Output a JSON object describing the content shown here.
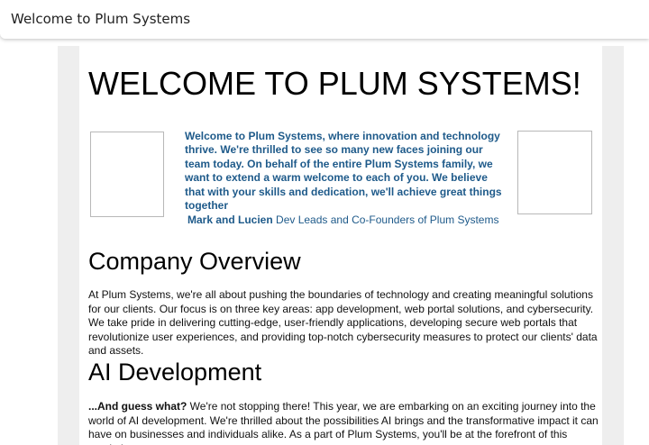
{
  "window": {
    "title": "Welcome to Plum Systems"
  },
  "hero": {
    "title": "WELCOME TO PLUM SYSTEMS!"
  },
  "welcome": {
    "message": "Welcome to Plum Systems, where innovation and technology thrive. We're thrilled to see so many new faces joining our team today. On behalf of the entire Plum Systems family, we want to extend a warm welcome to each of you. We believe that with your skills and dedication, we'll achieve great things together",
    "signature_names": "Mark and Lucien",
    "signature_role": " Dev Leads and Co-Founders of Plum Systems",
    "text_color": "#1e5a8a"
  },
  "overview": {
    "heading": "Company Overview",
    "body": "At Plum Systems, we're all about pushing the boundaries of technology and creating meaningful solutions for our clients. Our focus is on three key areas: app development, web portal solutions, and cybersecurity. We take pride in delivering cutting-edge, user-friendly applications, developing secure web portals that revolutionize user experiences, and providing top-notch cybersecurity measures to protect our clients' data and assets."
  },
  "ai": {
    "heading": "AI Development",
    "lead": "...And guess what?",
    "body": " We're not stopping there! This year, we are embarking on an exciting journey into the world of AI development. We're thrilled about the possibilities AI brings and the transformative impact it can have on businesses and individuals alike. As a part of Plum Systems, you'll be at the forefront of this revolution."
  },
  "colors": {
    "page_background": "#eeeeee",
    "content_background": "#ffffff"
  }
}
